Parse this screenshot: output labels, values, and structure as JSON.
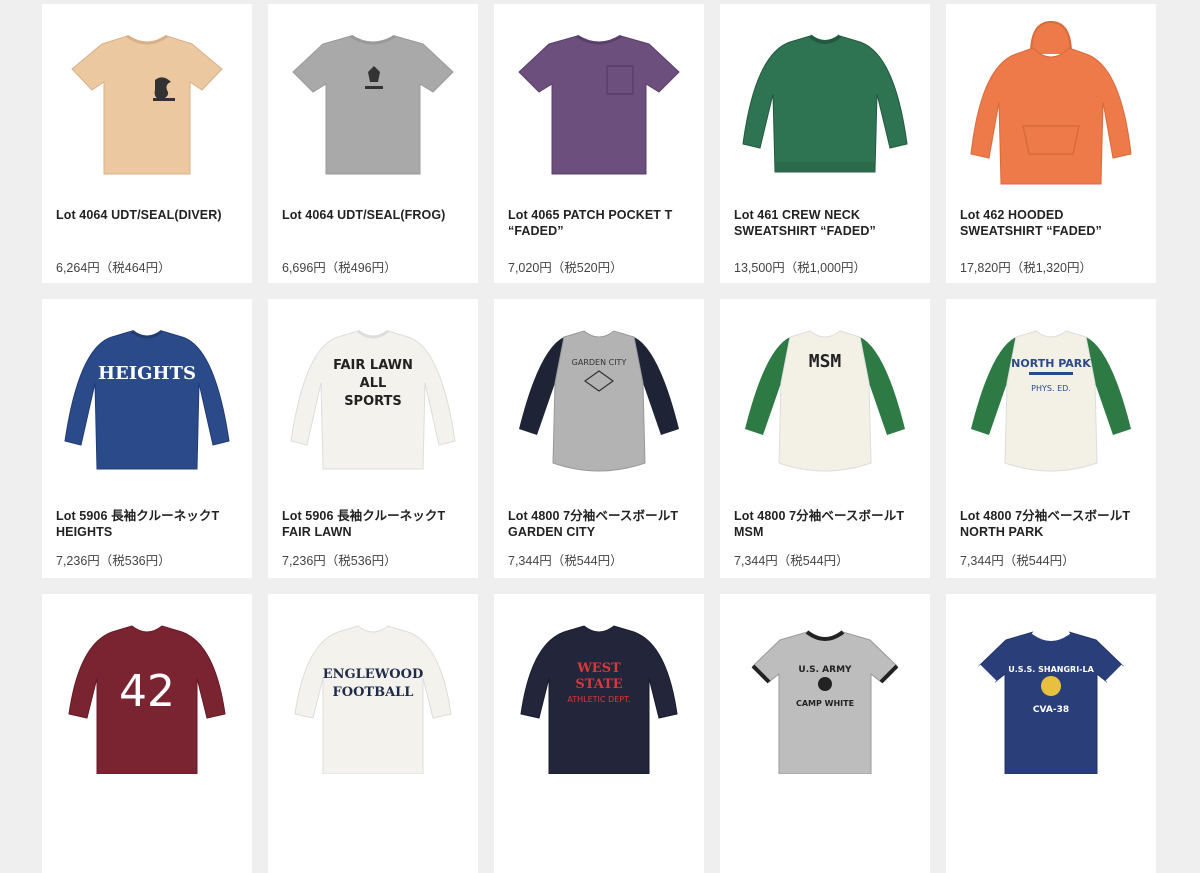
{
  "products": [
    {
      "name_line1": "Lot 4064 UDT/SEAL(DIVER)",
      "name_line2": "",
      "price": "6,264円（税464円）",
      "color": "#ecc8a0",
      "style": "tee",
      "print": "DIVER seal",
      "print_color": "#333"
    },
    {
      "name_line1": "Lot 4064 UDT/SEAL(FROG)",
      "name_line2": "",
      "price": "6,696円（税496円）",
      "color": "#a9a9a9",
      "style": "tee",
      "print": "FROG seal",
      "print_color": "#333"
    },
    {
      "name_line1": "Lot 4065 PATCH POCKET T",
      "name_line2": "“FADED”",
      "price": "7,020円（税520円）",
      "color": "#6c4f7c",
      "style": "pocket-tee",
      "print": "",
      "print_color": "#333"
    },
    {
      "name_line1": "Lot 461 CREW NECK",
      "name_line2": "SWEATSHIRT “FADED”",
      "price": "13,500円（税1,000円）",
      "color": "#2f7452",
      "style": "sweat",
      "print": "",
      "print_color": "#333"
    },
    {
      "name_line1": "Lot 462 HOODED",
      "name_line2": "SWEATSHIRT “FADED”",
      "price": "17,820円（税1,320円）",
      "color": "#ee7a4a",
      "style": "hoodie",
      "print": "",
      "print_color": "#333"
    },
    {
      "name_line1": "Lot 5906 長袖クルーネックT",
      "name_line2": "HEIGHTS",
      "price": "7,236円（税536円）",
      "color": "#2b4a8a",
      "style": "longsleeve",
      "print": "HEIGHTS",
      "print_color": "#ffffff"
    },
    {
      "name_line1": "Lot 5906 長袖クルーネックT",
      "name_line2": "FAIR LAWN",
      "price": "7,236円（税536円）",
      "color": "#f4f2ec",
      "style": "longsleeve",
      "print": "FAIR LAWN ALL SPORTS",
      "print_color": "#222"
    },
    {
      "name_line1": "Lot 4800 7分袖ベースボールT",
      "name_line2": "GARDEN CITY",
      "price": "7,344円（税544円）",
      "color": "#b3b3b3",
      "sleeve_color": "#1e2336",
      "style": "raglan",
      "print": "GARDEN CITY",
      "print_color": "#333"
    },
    {
      "name_line1": "Lot 4800 7分袖ベースボールT",
      "name_line2": "MSM",
      "price": "7,344円（税544円）",
      "color": "#f3f0e6",
      "sleeve_color": "#2e7a45",
      "style": "raglan",
      "print": "MSM",
      "print_color": "#222"
    },
    {
      "name_line1": "Lot 4800 7分袖ベースボールT",
      "name_line2": "NORTH PARK",
      "price": "7,344円（税544円）",
      "color": "#f3f0e6",
      "sleeve_color": "#2e7a45",
      "style": "raglan",
      "print": "NORTH PARK PHYS. ED.",
      "print_color": "#2b4a8a"
    },
    {
      "name_line1": "",
      "name_line2": "",
      "price": "",
      "color": "#7a2331",
      "style": "football",
      "print": "42",
      "print_color": "#ffffff"
    },
    {
      "name_line1": "",
      "name_line2": "",
      "price": "",
      "color": "#f4f2ec",
      "style": "longsleeve",
      "print": "ENGLEWOOD FOOTBALL",
      "print_color": "#1f2b4a"
    },
    {
      "name_line1": "",
      "name_line2": "",
      "price": "",
      "color": "#23263a",
      "style": "football",
      "print": "WEST STATE",
      "print_color": "#d8383d"
    },
    {
      "name_line1": "",
      "name_line2": "",
      "price": "",
      "color": "#bdbdbd",
      "style": "ringer",
      "print": "U.S. ARMY CAMP WHITE",
      "print_color": "#222"
    },
    {
      "name_line1": "",
      "name_line2": "",
      "price": "",
      "color": "#2a3f7a",
      "style": "ringer",
      "print": "U.S.S. SHANGRI-LA CVA-38",
      "print_color": "#ffffff"
    }
  ]
}
